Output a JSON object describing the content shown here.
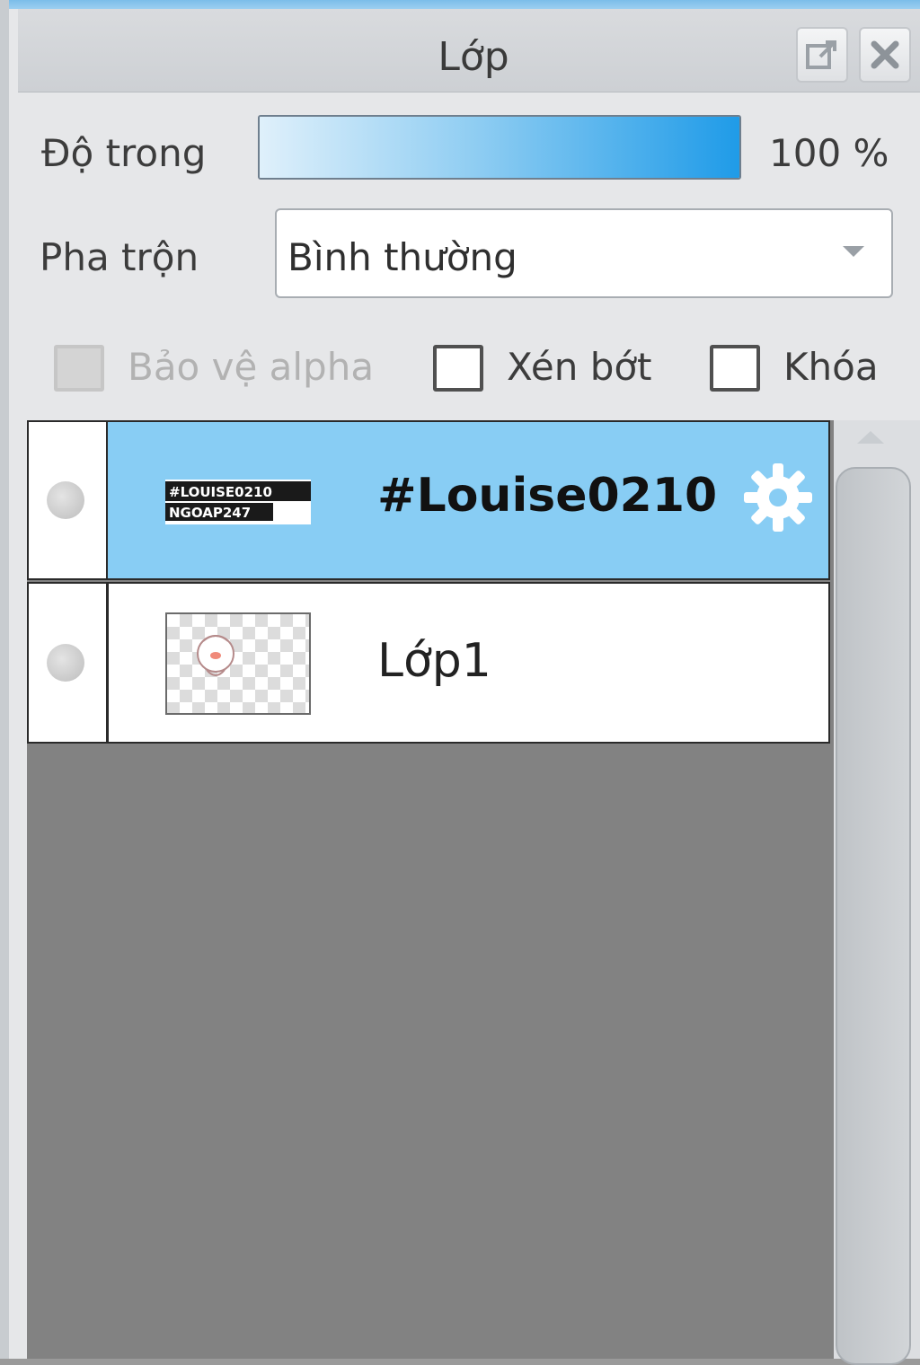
{
  "panel": {
    "title": "Lớp",
    "buttons": {
      "popout_icon": "popout-icon",
      "close_icon": "close-icon"
    }
  },
  "opacity": {
    "label": "Độ trong",
    "value_text": "100 %",
    "fraction": 1.0,
    "fill_color": "#1f9be8"
  },
  "blend": {
    "label": "Pha trộn",
    "selected": "Bình thường"
  },
  "options": {
    "protect_alpha": {
      "label": "Bảo vệ alpha",
      "checked": false,
      "enabled": false
    },
    "clip": {
      "label": "Xén bớt",
      "checked": false
    },
    "lock": {
      "label": "Khóa",
      "checked": false
    }
  },
  "layers": [
    {
      "name": "#Louise0210",
      "thumb_text": [
        "#LOUISE0210",
        "NGOAP247"
      ],
      "selected": true,
      "icon": "gear-icon"
    },
    {
      "name": "Lớp1",
      "selected": false
    }
  ],
  "colors": {
    "selected_row": "#88cdf4",
    "panel_bg": "#e6e7e9",
    "empty_area": "#828282"
  }
}
